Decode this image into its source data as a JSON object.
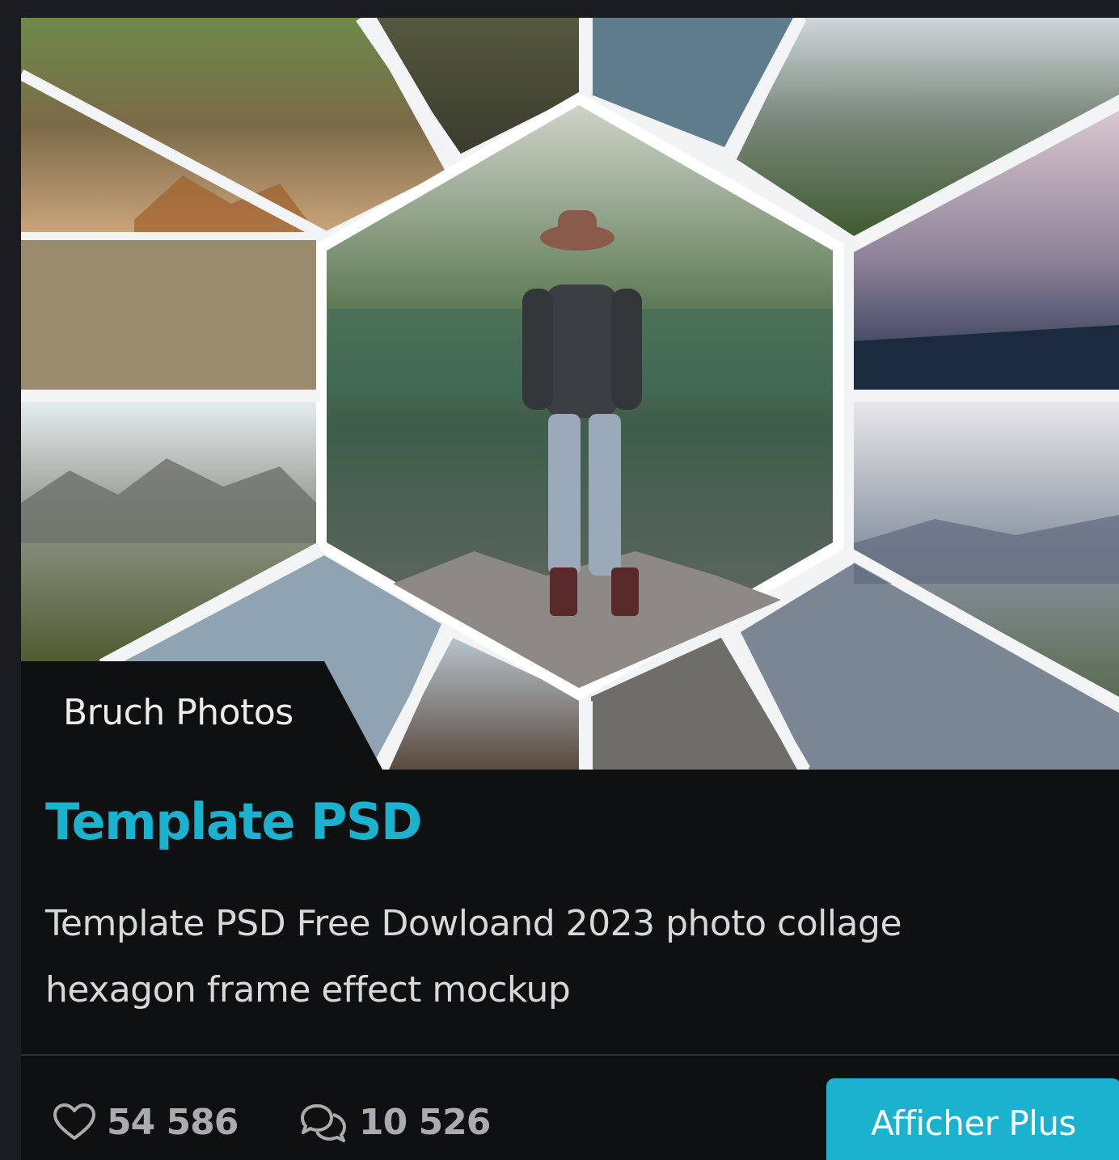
{
  "card": {
    "category": "Bruch Photos",
    "title": "Template PSD",
    "description": "Template PSD Free Dowloand 2023 photo collage hexagon frame effect mockup",
    "likes": "54 586",
    "comments": "10 526",
    "button_label": "Afficher Plus",
    "icons": {
      "likes": "heart-icon",
      "comments": "chat-bubbles-icon"
    }
  },
  "colors": {
    "accent": "#1ab2cf",
    "card_bg": "#0f1012",
    "page_bg": "#1b1c1f"
  }
}
